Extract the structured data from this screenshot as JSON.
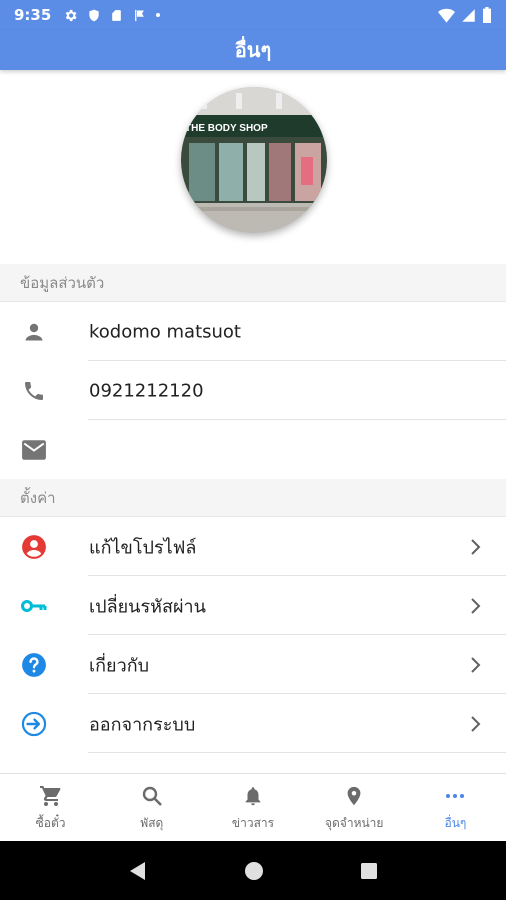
{
  "status_bar": {
    "time": "9:35"
  },
  "app_bar": {
    "title": "อื่นๆ"
  },
  "profile": {
    "avatar_icon": "store-photo",
    "store_sign": "THE BODY SHOP"
  },
  "personal_section": {
    "header": "ข้อมูลส่วนตัว",
    "rows": [
      {
        "icon": "person-icon",
        "value": "kodomo matsuot"
      },
      {
        "icon": "phone-icon",
        "value": "0921212120"
      },
      {
        "icon": "email-icon",
        "value": ""
      }
    ]
  },
  "settings_section": {
    "header": "ตั้งค่า",
    "rows": [
      {
        "icon": "account-circle-icon",
        "label": "แก้ไขโปรไฟล์",
        "color": "#e53935"
      },
      {
        "icon": "key-icon",
        "label": "เปลี่ยนรหัสผ่าน",
        "color": "#00bcd4"
      },
      {
        "icon": "help-icon",
        "label": "เกี่ยวกับ",
        "color": "#1e88e5"
      },
      {
        "icon": "logout-icon",
        "label": "ออกจากระบบ",
        "color": "#1e88e5"
      }
    ]
  },
  "bottom_nav": {
    "items": [
      {
        "icon": "cart-icon",
        "label": "ซื้อตั๋ว"
      },
      {
        "icon": "search-icon",
        "label": "พัสดุ"
      },
      {
        "icon": "bell-icon",
        "label": "ข่าวสาร"
      },
      {
        "icon": "location-icon",
        "label": "จุดจำหน่าย"
      },
      {
        "icon": "more-icon",
        "label": "อื่นๆ",
        "active": true
      }
    ]
  },
  "colors": {
    "primary": "#5b8de6",
    "active_tab": "#4a86e8"
  }
}
